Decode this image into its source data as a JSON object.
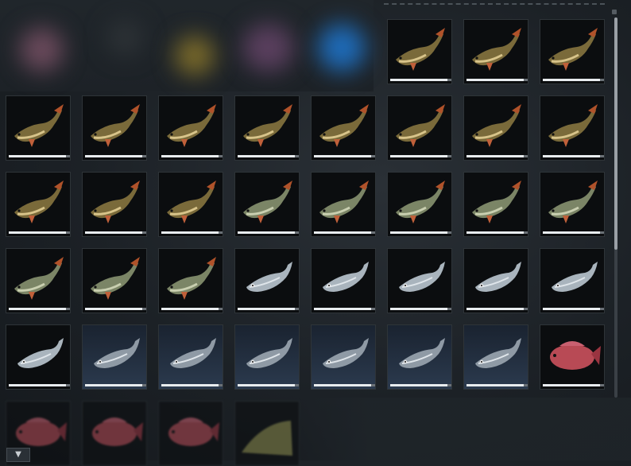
{
  "inventory": {
    "scroll_down_glyph": "▼",
    "slot_rows": [
      [
        "pike",
        "pike",
        "pike"
      ],
      [
        "pike",
        "pike",
        "pike",
        "pike",
        "pike",
        "pike",
        "pike",
        "pike"
      ],
      [
        "pike",
        "pike",
        "pike",
        "gar",
        "gar",
        "gar",
        "gar",
        "gar"
      ],
      [
        "gar",
        "gar",
        "gar",
        "herring",
        "herring",
        "herring",
        "herring",
        "herring"
      ],
      [
        "herring",
        "cod",
        "cod",
        "cod",
        "cod",
        "cod",
        "cod",
        "snapper"
      ],
      [
        "snapper",
        "snapper",
        "snapper",
        "bream"
      ]
    ],
    "colors": {
      "pike": "#7a6a3a",
      "gar": "#7b8566",
      "herring": "#a9b4bd",
      "cod": "#8f9aa5",
      "snapper": "#b84a55",
      "bream": "#8a8a4a",
      "slot_bg": "#0b0d0f",
      "accent": "#e8ecef"
    },
    "blurred_items": [
      "pink-orb",
      "dark-orb",
      "yellow-orb",
      "purple-orb",
      "blue-orb"
    ]
  }
}
